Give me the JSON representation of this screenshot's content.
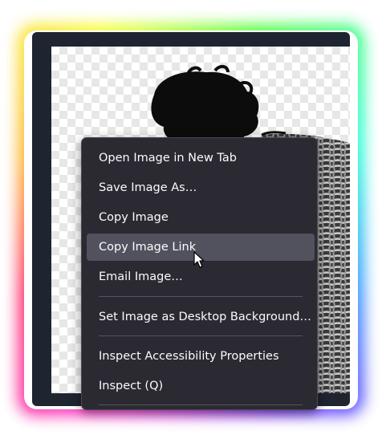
{
  "context_menu": {
    "items": [
      {
        "label": "Open Image in New Tab",
        "hovered": false
      },
      {
        "label": "Save Image As…",
        "hovered": false
      },
      {
        "label": "Copy Image",
        "hovered": false
      },
      {
        "label": "Copy Image Link",
        "hovered": true
      },
      {
        "label": "Email Image…",
        "hovered": false
      },
      {
        "label": "Set Image as Desktop Background…",
        "hovered": false
      },
      {
        "label": "Inspect Accessibility Properties",
        "hovered": false
      },
      {
        "label": "Inspect (Q)",
        "hovered": false
      }
    ]
  },
  "colors": {
    "menu_background": "#2b2a33",
    "menu_hover": "#52525e",
    "menu_text": "#fbfbfe",
    "window_background": "#1f2431"
  },
  "icons": {
    "cursor": "arrow-cursor-icon"
  }
}
